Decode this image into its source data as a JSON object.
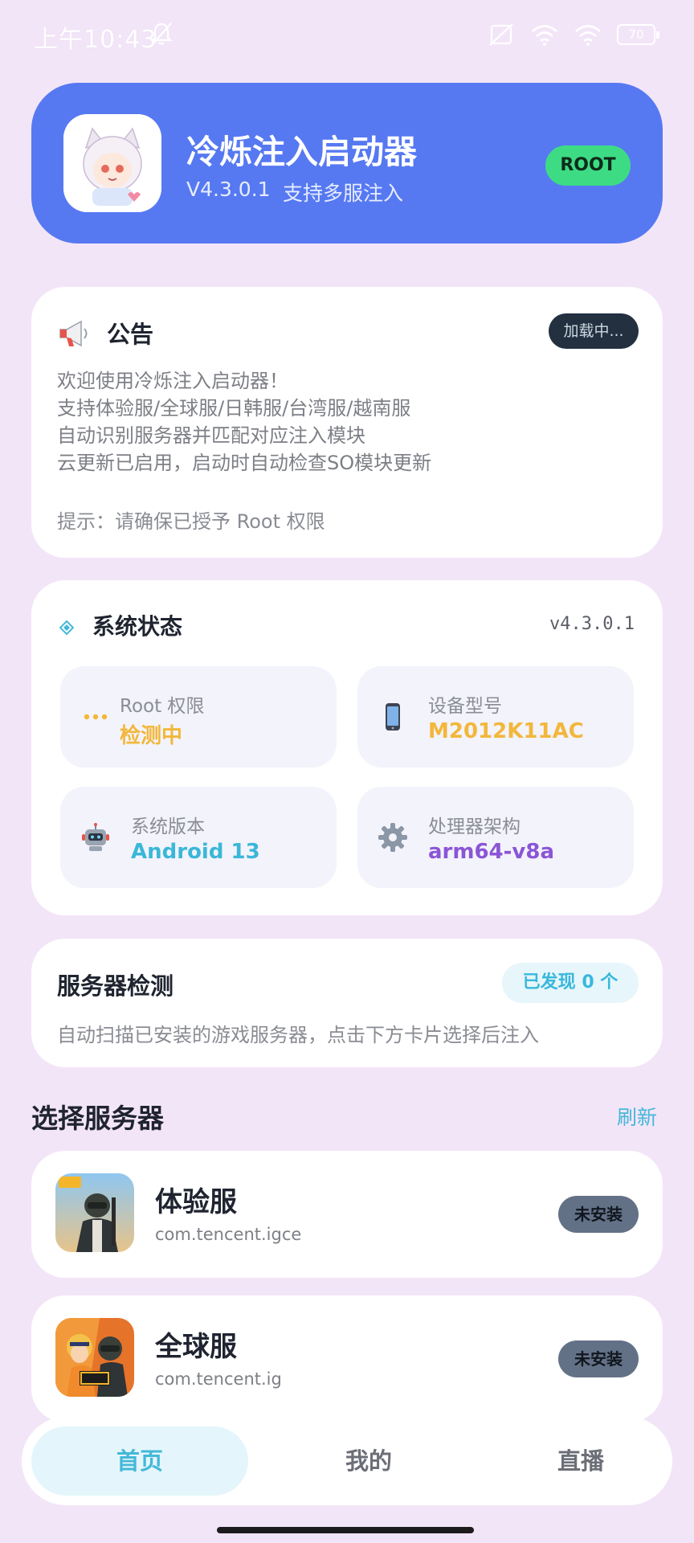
{
  "status_bar": {
    "time": "上午10:43",
    "battery": "70"
  },
  "header": {
    "title": "冷烁注入启动器",
    "version": "V4.3.0.1",
    "tagline": "支持多服注入",
    "root_badge": "ROOT"
  },
  "notice": {
    "title": "公告",
    "loading": "加载中...",
    "lines": [
      "欢迎使用冷烁注入启动器！",
      "支持体验服/全球服/日韩服/台湾服/越南服",
      "自动识别服务器并匹配对应注入模块",
      "云更新已启用，启动时自动检查SO模块更新"
    ],
    "tip": "提示：请确保已授予 Root 权限"
  },
  "system_status": {
    "title": "系统状态",
    "version": "v4.3.0.1",
    "tiles": [
      {
        "label": "Root 权限",
        "value": "检测中",
        "icon": "ellipsis-icon",
        "color": "#f2b73b"
      },
      {
        "label": "设备型号",
        "value": "M2012K11AC",
        "icon": "phone-icon",
        "color": "#f2b73b"
      },
      {
        "label": "系统版本",
        "value": "Android 13",
        "icon": "robot-icon",
        "color": "#3bb7d8"
      },
      {
        "label": "处理器架构",
        "value": "arm64-v8a",
        "icon": "gear-icon",
        "color": "#8a55d6"
      }
    ]
  },
  "server_detect": {
    "title": "服务器检测",
    "found": "已发现 0 个",
    "description": "自动扫描已安装的游戏服务器，点击下方卡片选择后注入"
  },
  "select_servers": {
    "title": "选择服务器",
    "refresh": "刷新",
    "servers": [
      {
        "name": "体验服",
        "package": "com.tencent.igce",
        "status": "未安装"
      },
      {
        "name": "全球服",
        "package": "com.tencent.ig",
        "status": "未安装"
      }
    ]
  },
  "bottom_nav": {
    "items": [
      "首页",
      "我的",
      "直播"
    ],
    "active": "首页"
  },
  "colors": {
    "background": "#f3e5f8",
    "header": "#5679f2",
    "root_badge": "#3ddc84",
    "accent": "#45b8d8"
  }
}
